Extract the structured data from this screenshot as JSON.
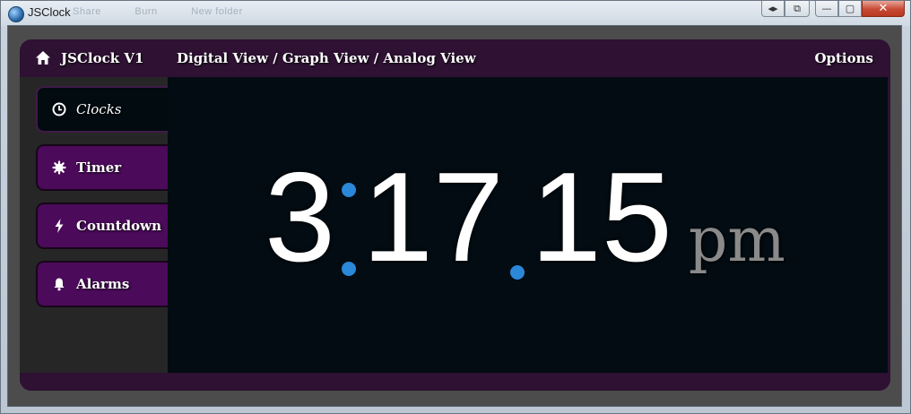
{
  "window": {
    "title": "JSClock",
    "ghost_menu": [
      "Share",
      "Burn",
      "New folder"
    ],
    "buttons": {
      "extra1": "◂▸",
      "extra2": "⧉",
      "minimize": "—",
      "maximize": "▢",
      "close": "✕"
    }
  },
  "topbar": {
    "brand": "JSClock V1",
    "views": "Digital View / Graph View / Analog View",
    "options": "Options"
  },
  "sidebar": {
    "items": [
      {
        "label": "Clocks",
        "icon": "clock-icon",
        "active": true
      },
      {
        "label": "Timer",
        "icon": "burst-icon",
        "active": false
      },
      {
        "label": "Countdown",
        "icon": "lightning-icon",
        "active": false
      },
      {
        "label": "Alarms",
        "icon": "bell-icon",
        "active": false
      }
    ]
  },
  "clock": {
    "hours": "3",
    "minutes": "17",
    "seconds": "15",
    "ampm": "pm"
  },
  "colors": {
    "accent_dot": "#2b87d8",
    "frame_purple": "#2e1133",
    "nav_purple": "#4b0a5a",
    "display_bg": "#020c12"
  }
}
